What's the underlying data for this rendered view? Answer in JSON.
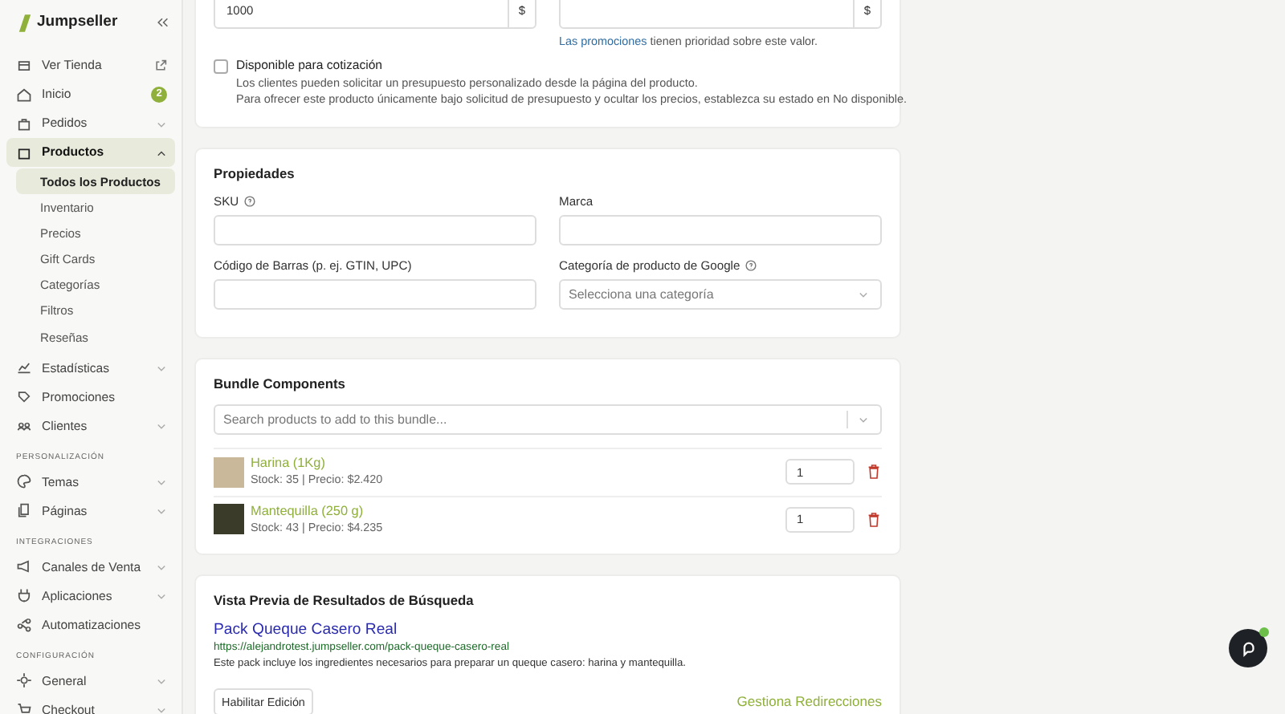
{
  "sidebar": {
    "logo": "Jumpseller",
    "groups": [
      {
        "items": [
          {
            "label": "Ver Tienda",
            "kind": "link"
          },
          {
            "label": "Inicio",
            "kind": "badge",
            "badge": "2"
          },
          {
            "label": "Pedidos",
            "kind": "expandable",
            "expanded": false,
            "selected": false
          },
          {
            "label": "Productos",
            "kind": "expandable",
            "expanded": true,
            "selected": true,
            "children": [
              {
                "label": "Todos los Productos",
                "selected": true
              },
              {
                "label": "Inventario",
                "selected": false
              },
              {
                "label": "Precios",
                "selected": false
              },
              {
                "label": "Gift Cards",
                "selected": false
              },
              {
                "label": "Categorías",
                "selected": false
              },
              {
                "label": "Filtros",
                "selected": false
              },
              {
                "label": "Reseñas",
                "selected": false
              }
            ]
          },
          {
            "label": "Estadísticas",
            "kind": "expandable",
            "expanded": false,
            "selected": false
          },
          {
            "label": "Promociones",
            "kind": "plain"
          },
          {
            "label": "Clientes",
            "kind": "expandable",
            "expanded": false,
            "selected": false
          }
        ]
      },
      {
        "heading": "PERSONALIZACIÓN",
        "items": [
          {
            "label": "Temas",
            "kind": "expandable",
            "expanded": false,
            "selected": false
          },
          {
            "label": "Páginas",
            "kind": "expandable",
            "expanded": false,
            "selected": false
          }
        ]
      },
      {
        "heading": "INTEGRACIONES",
        "items": [
          {
            "label": "Canales de Venta",
            "kind": "expandable",
            "expanded": false,
            "selected": false
          },
          {
            "label": "Aplicaciones",
            "kind": "expandable",
            "expanded": false,
            "selected": false
          },
          {
            "label": "Automatizaciones",
            "kind": "plain"
          }
        ]
      },
      {
        "heading": "CONFIGURACIÓN",
        "items": [
          {
            "label": "General",
            "kind": "expandable",
            "expanded": false,
            "selected": false
          },
          {
            "label": "Checkout",
            "kind": "expandable",
            "expanded": false,
            "selected": false
          }
        ]
      }
    ]
  },
  "pricing": {
    "fields": [
      {
        "value": "1000",
        "suffix": "$"
      },
      {
        "suffix": "$"
      }
    ],
    "note": {
      "link": "Las promociones",
      "text": "tienen prioridad sobre este valor."
    },
    "quote": {
      "label": "Disponible para cotización",
      "checked": false,
      "lines": [
        "Los clientes pueden solicitar un presupuesto personalizado desde la página del producto.",
        "Para ofrecer este producto únicamente bajo solicitud de presupuesto y ocultar los precios, establezca su estado en No disponible."
      ]
    }
  },
  "properties": {
    "title": "Propiedades",
    "fields": [
      {
        "label": "SKU",
        "help": true,
        "kind": "input"
      },
      {
        "label": "Marca",
        "help": false,
        "kind": "input"
      },
      {
        "label": "Código de Barras (p. ej. GTIN, UPC)",
        "help": false,
        "kind": "input"
      },
      {
        "label": "Categoría de producto de Google",
        "help": true,
        "kind": "select",
        "placeholder": "Selecciona una categoría"
      }
    ]
  },
  "bundle": {
    "title": "Bundle Components",
    "search": {
      "placeholder": "Search products to add to this bundle..."
    },
    "items": [
      {
        "name": "Harina (1Kg)",
        "meta": "Stock: 35 | Precio: $2.420",
        "quantity": "1"
      },
      {
        "name": "Mantequilla (250 g)",
        "meta": "Stock: 43 | Precio: $4.235",
        "quantity": "1"
      }
    ]
  },
  "seo": {
    "title": "Vista Previa de Resultados de Búsqueda",
    "preview_title": "Pack Queque Casero Real",
    "url": "https://alejandrotest.jumpseller.com/pack-queque-casero-real",
    "description": "Este pack incluye los ingredientes necesarios para preparar un queque casero: harina y mantequilla.",
    "button": "Habilitar Edición",
    "link": "Gestiona Redirecciones"
  }
}
